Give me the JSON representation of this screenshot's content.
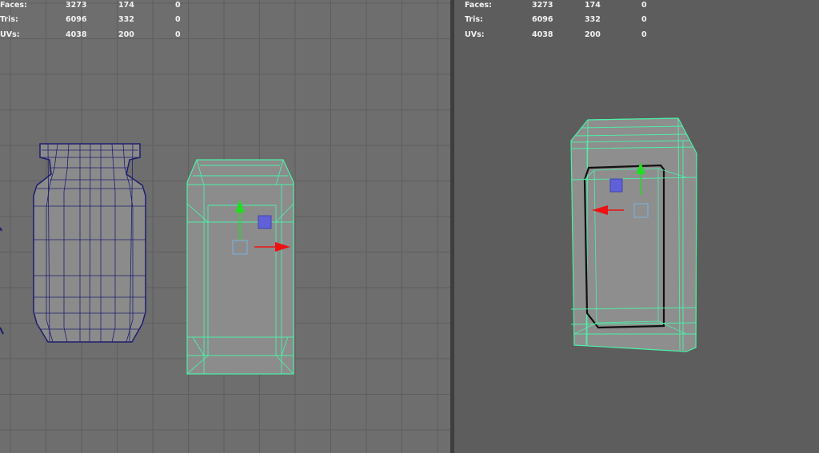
{
  "hud": {
    "rows": [
      {
        "label": "Faces:",
        "scene": "3273",
        "object": "174",
        "selected": "0"
      },
      {
        "label": "Tris:",
        "scene": "6096",
        "object": "332",
        "selected": "0"
      },
      {
        "label": "UVs:",
        "scene": "4038",
        "object": "200",
        "selected": "0"
      }
    ]
  },
  "colors": {
    "left_viewport_bg": "#6e6e6e",
    "right_viewport_bg": "#5d5d5d",
    "grid_line": "#5e5e5e",
    "wireframe_selected": "#4cf0a8",
    "wireframe_mesh": "#1e1e6e",
    "mesh_fill": "#8b8b8b",
    "manipulator_y": "#22dd22",
    "manipulator_x": "#ee1111",
    "manipulator_plane": "#6060d8"
  },
  "icons": {
    "move_y_arrow": "green-up-arrow",
    "move_x_arrow": "red-right-arrow",
    "move_plane": "blue-square",
    "move_center": "outline-square"
  }
}
